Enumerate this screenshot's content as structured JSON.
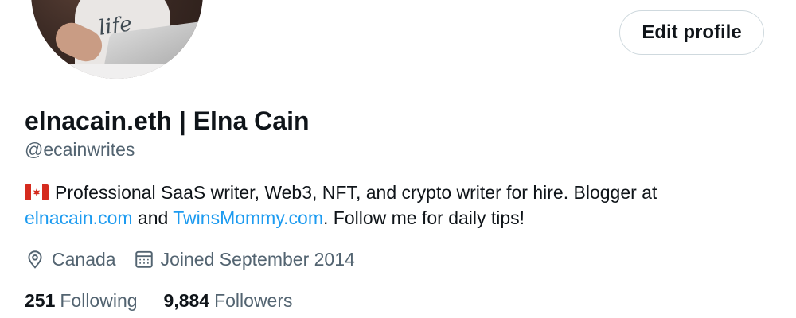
{
  "profile": {
    "display_name": "elnacain.eth | Elna Cain",
    "handle": "@ecainwrites",
    "edit_button_label": "Edit profile",
    "avatar_shirt_text": "life",
    "bio": {
      "line1_text": "Professional SaaS writer, Web3, NFT, and crypto writer for hire. Blogger at",
      "link1": "elnacain.com",
      "and_text": " and ",
      "link2": "TwinsMommy.com",
      "tail_text": ". Follow me for daily tips!",
      "flag_icon": "canada-flag-icon"
    },
    "meta": {
      "location": "Canada",
      "location_icon": "location-pin-icon",
      "joined": "Joined September 2014",
      "joined_icon": "calendar-icon"
    },
    "stats": {
      "following_count": "251",
      "following_label": "Following",
      "followers_count": "9,884",
      "followers_label": "Followers"
    }
  },
  "colors": {
    "text_primary": "#0f1419",
    "text_secondary": "#536471",
    "link": "#1d9bf0",
    "button_border": "#cfd9de",
    "flag_red": "#d52b1e"
  }
}
